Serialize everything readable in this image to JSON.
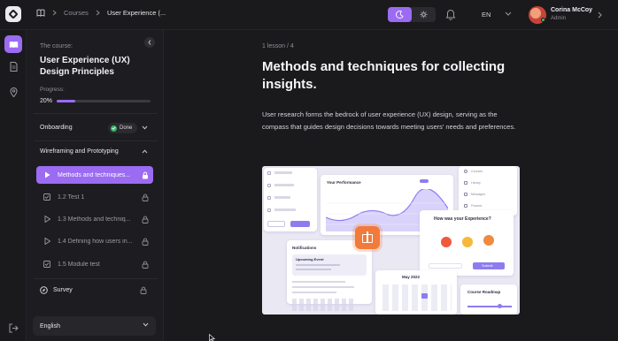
{
  "topbar": {
    "breadcrumb": {
      "courses": "Courses",
      "current": "User Experience (..."
    },
    "theme": {
      "active": "dark"
    },
    "language": "EN",
    "user": {
      "name": "Corina McCoy",
      "role": "Admin"
    }
  },
  "course": {
    "label": "The course:",
    "title": "User Experience (UX) Design Principles",
    "progress_label": "Progress:",
    "progress_pct": "20%",
    "progress_value": 0.2,
    "sections": [
      {
        "title": "Onboarding",
        "status": "Done"
      },
      {
        "title": "Wireframing and Prototyping"
      }
    ],
    "lessons": [
      {
        "title": "Methods and techniques...",
        "icon": "play-icon",
        "active": true
      },
      {
        "title": "1.2 Test 1",
        "icon": "check-square-icon"
      },
      {
        "title": "1.3 Methods and techniq...",
        "icon": "play-icon"
      },
      {
        "title": "1.4 Defining how users in...",
        "icon": "play-icon"
      },
      {
        "title": "1.5 Module test",
        "icon": "check-square-icon"
      }
    ],
    "survey": "Survey",
    "language_select": "English"
  },
  "main": {
    "meta": "1 lesson /  4",
    "title": "Methods and techniques for collecting insights.",
    "body": "User research forms the bedrock of user experience (UX) design, serving as the compass that guides design decisions towards meeting users' needs and preferences.",
    "cover": {
      "performance": "Your Performance",
      "notifications": "Notifications",
      "upcoming": "Upcoming Event",
      "experience": "How was your Experience?",
      "submit": "Submit",
      "month": "May 2022",
      "roadmap": "Course Roadmap",
      "menu": [
        "Courses",
        "Library",
        "Messages",
        "Finance"
      ]
    }
  },
  "colors": {
    "accent": "#9b6bf2",
    "success": "#34b865",
    "background": "#1a1a1d"
  }
}
